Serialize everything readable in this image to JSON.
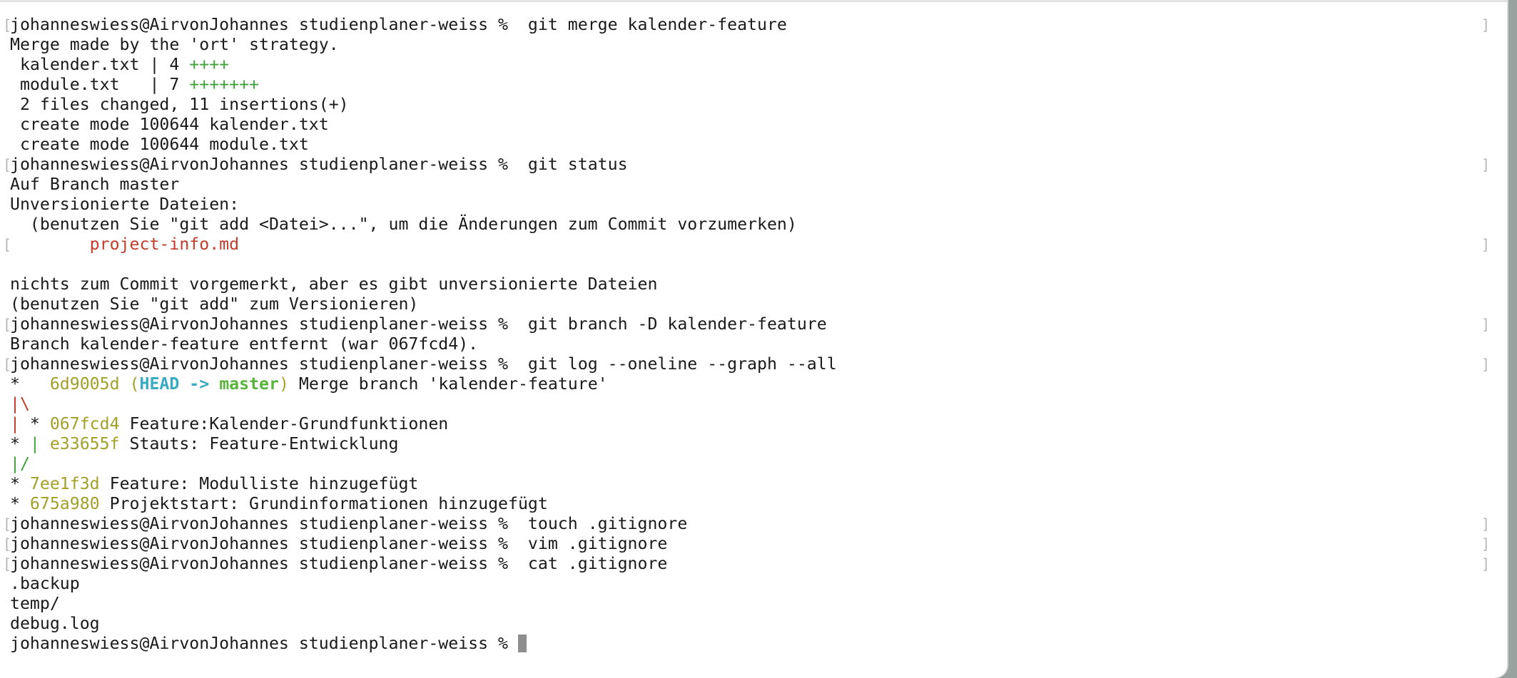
{
  "terminal": {
    "prompt": "johanneswiess@AirvonJohannes studienplaner-weiss % ",
    "colors": {
      "text": "#1a1a1a",
      "insertions": "#3fa33a",
      "untracked": "#c23b2a",
      "hash": "#a3a02a",
      "head": "#3aa9c2",
      "branch": "#58b43a",
      "graph_red": "#c23b2a",
      "graph_green": "#3fa33a"
    },
    "lines": [
      {
        "kind": "cmd",
        "cmd": " git merge kalender-feature"
      },
      {
        "kind": "out",
        "text": "Merge made by the 'ort' strategy."
      },
      {
        "kind": "stat",
        "name": " kalender.txt | 4 ",
        "plus": "++++"
      },
      {
        "kind": "stat",
        "name": " module.txt   | 7 ",
        "plus": "+++++++"
      },
      {
        "kind": "out",
        "text": " 2 files changed, 11 insertions(+)"
      },
      {
        "kind": "out",
        "text": " create mode 100644 kalender.txt"
      },
      {
        "kind": "out",
        "text": " create mode 100644 module.txt"
      },
      {
        "kind": "cmd",
        "cmd": " git status"
      },
      {
        "kind": "out",
        "text": "Auf Branch master"
      },
      {
        "kind": "out",
        "text": "Unversionierte Dateien:"
      },
      {
        "kind": "out",
        "text": "  (benutzen Sie \"git add <Datei>...\", um die Änderungen zum Commit vorzumerken)"
      },
      {
        "kind": "untracked",
        "text": "\tproject-info.md"
      },
      {
        "kind": "blank"
      },
      {
        "kind": "out",
        "text": "nichts zum Commit vorgemerkt, aber es gibt unversionierte Dateien"
      },
      {
        "kind": "out",
        "text": "(benutzen Sie \"git add\" zum Versionieren)"
      },
      {
        "kind": "cmd",
        "cmd": " git branch -D kalender-feature"
      },
      {
        "kind": "out",
        "text": "Branch kalender-feature entfernt (war 067fcd4)."
      },
      {
        "kind": "cmd",
        "cmd": " git log --oneline --graph --all"
      },
      {
        "kind": "graph",
        "parts": [
          {
            "t": "*   ",
            "c": ""
          },
          {
            "t": "6d9005d ",
            "c": "c-yellow"
          },
          {
            "t": "(",
            "c": "c-yellow"
          },
          {
            "t": "HEAD -> ",
            "c": "c-cyan"
          },
          {
            "t": "master",
            "c": "c-lgreen"
          },
          {
            "t": ")",
            "c": "c-yellow"
          },
          {
            "t": " Merge branch 'kalender-feature'",
            "c": ""
          }
        ]
      },
      {
        "kind": "graph",
        "parts": [
          {
            "t": "|\\",
            "c": "c-red"
          }
        ]
      },
      {
        "kind": "graph",
        "parts": [
          {
            "t": "| ",
            "c": "c-red"
          },
          {
            "t": "* ",
            "c": ""
          },
          {
            "t": "067fcd4 ",
            "c": "c-yellow"
          },
          {
            "t": "Feature:Kalender-Grundfunktionen",
            "c": ""
          }
        ]
      },
      {
        "kind": "graph",
        "parts": [
          {
            "t": "* ",
            "c": ""
          },
          {
            "t": "| ",
            "c": "c-green"
          },
          {
            "t": "e33655f ",
            "c": "c-yellow"
          },
          {
            "t": "Stauts: Feature-Entwicklung",
            "c": ""
          }
        ]
      },
      {
        "kind": "graph",
        "parts": [
          {
            "t": "|/",
            "c": "c-green"
          }
        ]
      },
      {
        "kind": "graph",
        "parts": [
          {
            "t": "* ",
            "c": ""
          },
          {
            "t": "7ee1f3d ",
            "c": "c-yellow"
          },
          {
            "t": "Feature: Modulliste hinzugefügt",
            "c": ""
          }
        ]
      },
      {
        "kind": "graph",
        "parts": [
          {
            "t": "* ",
            "c": ""
          },
          {
            "t": "675a980 ",
            "c": "c-yellow"
          },
          {
            "t": "Projektstart: Grundinformationen hinzugefügt",
            "c": ""
          }
        ]
      },
      {
        "kind": "cmd",
        "cmd": " touch .gitignore"
      },
      {
        "kind": "cmd",
        "cmd": " vim .gitignore"
      },
      {
        "kind": "cmd",
        "cmd": " cat .gitignore"
      },
      {
        "kind": "out",
        "text": ".backup"
      },
      {
        "kind": "out",
        "text": "temp/"
      },
      {
        "kind": "out",
        "text": "debug.log"
      },
      {
        "kind": "prompt"
      }
    ]
  }
}
